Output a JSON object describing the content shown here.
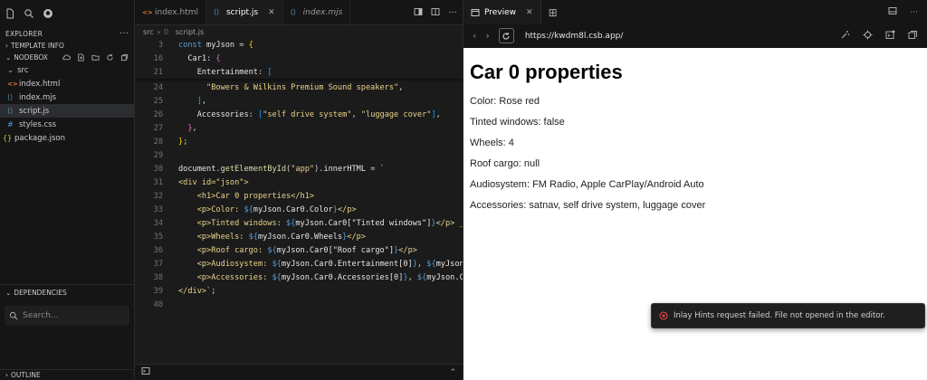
{
  "sidebar": {
    "explorer_title": "EXPLORER",
    "more": "···",
    "template_info": "TEMPLATE INFO",
    "nodebox_title": "NODEBOX",
    "tree": [
      {
        "label": "src",
        "type": "folder",
        "indent": 0
      },
      {
        "label": "index.html",
        "type": "html",
        "indent": 1
      },
      {
        "label": "index.mjs",
        "type": "js",
        "indent": 1
      },
      {
        "label": "script.js",
        "type": "js",
        "indent": 1,
        "selected": true
      },
      {
        "label": "styles.css",
        "type": "css",
        "indent": 1
      },
      {
        "label": "package.json",
        "type": "json",
        "indent": 0
      }
    ],
    "dependencies_title": "DEPENDENCIES",
    "search_placeholder": "Search...",
    "outline_title": "OUTLINE"
  },
  "editor": {
    "tabs": [
      {
        "label": "index.html",
        "icon": "html-file-icon",
        "active": false,
        "italic": false
      },
      {
        "label": "script.js",
        "icon": "js-file-icon",
        "active": true,
        "italic": false
      },
      {
        "label": "index.mjs",
        "icon": "js-file-icon",
        "active": false,
        "italic": true
      }
    ],
    "breadcrumb": {
      "folder": "src",
      "file": "script.js"
    },
    "lines": [
      {
        "n": "3",
        "sticky": true,
        "code": [
          [
            "kw",
            "const "
          ],
          [
            "vr",
            "myJson"
          ],
          [
            "pr",
            " = "
          ],
          [
            "br1",
            "{"
          ]
        ]
      },
      {
        "n": "16",
        "sticky": true,
        "code": [
          [
            "pr",
            "  "
          ],
          [
            "vr",
            "Car1"
          ],
          [
            "pr",
            ": "
          ],
          [
            "br2",
            "{"
          ]
        ]
      },
      {
        "n": "21",
        "sticky": true,
        "code": [
          [
            "pr",
            "    "
          ],
          [
            "vr",
            "Entertainment"
          ],
          [
            "pr",
            ": "
          ],
          [
            "br3",
            "["
          ]
        ]
      },
      {
        "n": "24",
        "sticky": false,
        "code": [
          [
            "pr",
            "      "
          ],
          [
            "st",
            "\"Bowers & Wilkins Premium Sound speakers\""
          ],
          [
            "pr",
            ","
          ]
        ]
      },
      {
        "n": "25",
        "sticky": false,
        "code": [
          [
            "pr",
            "    "
          ],
          [
            "br3",
            "]"
          ],
          [
            "pr",
            ","
          ]
        ]
      },
      {
        "n": "26",
        "sticky": false,
        "code": [
          [
            "pr",
            "    "
          ],
          [
            "vr",
            "Accessories"
          ],
          [
            "pr",
            ": "
          ],
          [
            "br3",
            "["
          ],
          [
            "st",
            "\"self drive system\""
          ],
          [
            "pr",
            ", "
          ],
          [
            "st",
            "\"luggage cover\""
          ],
          [
            "br3",
            "]"
          ],
          [
            "pr",
            ","
          ]
        ]
      },
      {
        "n": "27",
        "sticky": false,
        "code": [
          [
            "pr",
            "  "
          ],
          [
            "br2",
            "}"
          ],
          [
            "pr",
            ","
          ]
        ]
      },
      {
        "n": "28",
        "sticky": false,
        "code": [
          [
            "br1",
            "}"
          ],
          [
            "pr",
            ";"
          ]
        ]
      },
      {
        "n": "29",
        "sticky": false,
        "code": []
      },
      {
        "n": "30",
        "sticky": false,
        "code": [
          [
            "vr",
            "document"
          ],
          [
            "pr",
            "."
          ],
          [
            "fn",
            "getElementById"
          ],
          [
            "pr",
            "("
          ],
          [
            "st",
            "\"app\""
          ],
          [
            "pr",
            ")."
          ],
          [
            "vr",
            "innerHTML"
          ],
          [
            "pr",
            " = "
          ],
          [
            "tpl",
            "`"
          ]
        ]
      },
      {
        "n": "31",
        "sticky": false,
        "code": [
          [
            "tpl",
            "<div id=\"json\">"
          ]
        ]
      },
      {
        "n": "32",
        "sticky": false,
        "code": [
          [
            "tpl",
            "    <h1>Car 0 properties</h1>"
          ]
        ]
      },
      {
        "n": "33",
        "sticky": false,
        "code": [
          [
            "tpl",
            "    <p>Color: "
          ],
          [
            "kw",
            "${"
          ],
          [
            "ex",
            "myJson.Car0.Color"
          ],
          [
            "kw",
            "}"
          ],
          [
            "tpl",
            "</p>"
          ]
        ]
      },
      {
        "n": "34",
        "sticky": false,
        "code": [
          [
            "tpl",
            "    <p>Tinted windows: "
          ],
          [
            "kw",
            "${"
          ],
          [
            "ex",
            "myJson.Car0[\"Tinted windows\"]"
          ],
          [
            "kw",
            "}"
          ],
          [
            "tpl",
            "</p> _"
          ]
        ]
      },
      {
        "n": "35",
        "sticky": false,
        "code": [
          [
            "tpl",
            "    <p>Wheels: "
          ],
          [
            "kw",
            "${"
          ],
          [
            "ex",
            "myJson.Car0.Wheels"
          ],
          [
            "kw",
            "}"
          ],
          [
            "tpl",
            "</p>"
          ]
        ]
      },
      {
        "n": "36",
        "sticky": false,
        "code": [
          [
            "tpl",
            "    <p>Roof cargo: "
          ],
          [
            "kw",
            "${"
          ],
          [
            "ex",
            "myJson.Car0[\"Roof cargo\"]"
          ],
          [
            "kw",
            "}"
          ],
          [
            "tpl",
            "</p>"
          ]
        ]
      },
      {
        "n": "37",
        "sticky": false,
        "code": [
          [
            "tpl",
            "    <p>Audiosystem: "
          ],
          [
            "kw",
            "${"
          ],
          [
            "ex",
            "myJson.Car0.Entertainment[0]"
          ],
          [
            "kw",
            "}"
          ],
          [
            "tpl",
            ", "
          ],
          [
            "kw",
            "${"
          ],
          [
            "ex",
            "myJson"
          ]
        ]
      },
      {
        "n": "38",
        "sticky": false,
        "code": [
          [
            "tpl",
            "    <p>Accessories: "
          ],
          [
            "kw",
            "${"
          ],
          [
            "ex",
            "myJson.Car0.Accessories[0]"
          ],
          [
            "kw",
            "}"
          ],
          [
            "tpl",
            ", "
          ],
          [
            "kw",
            "${"
          ],
          [
            "ex",
            "myJson.C"
          ]
        ]
      },
      {
        "n": "39",
        "sticky": false,
        "code": [
          [
            "tpl",
            "</div>`"
          ],
          [
            "pr",
            ";"
          ]
        ]
      },
      {
        "n": "40",
        "sticky": false,
        "code": []
      }
    ]
  },
  "preview": {
    "tab_label": "Preview",
    "url": "https://kwdm8l.csb.app/",
    "page": {
      "heading": "Car 0 properties",
      "paragraphs": [
        "Color: Rose red",
        "Tinted windows: false",
        "Wheels: 4",
        "Roof cargo: null",
        "Audiosystem: FM Radio, Apple CarPlay/Android Auto",
        "Accessories: satnav, self drive system, luggage cover"
      ]
    },
    "toast": "Inlay Hints request failed. File not opened in the editor."
  },
  "colors": {
    "accent": "#3794ff",
    "error": "#f14c4c",
    "preview_bg": "#ffffff"
  }
}
